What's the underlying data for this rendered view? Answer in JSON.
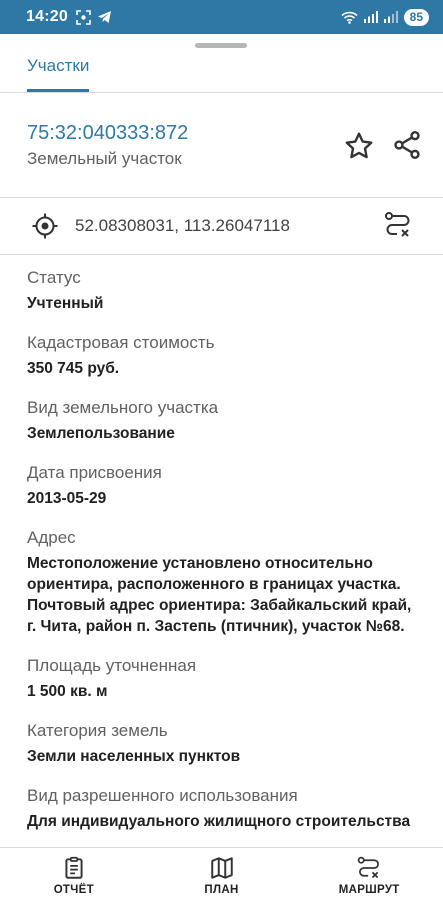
{
  "status_bar": {
    "time": "14:20",
    "battery": "85",
    "left_icons": [
      "screenshot-icon",
      "telegram-icon"
    ],
    "right_icons": [
      "wifi-icon",
      "signal-icon",
      "signal-icon"
    ]
  },
  "tabs": [
    {
      "label": "Участки",
      "active": true
    }
  ],
  "header": {
    "cadastral_number": "75:32:040333:872",
    "object_type": "Земельный участок",
    "favorite_icon": "star-icon",
    "share_icon": "share-icon"
  },
  "coordinates": {
    "text": "52.08308031, 113.26047118",
    "location_icon": "target-icon",
    "route_icon": "route-clear-icon"
  },
  "properties": [
    {
      "label": "Статус",
      "value": "Учтенный"
    },
    {
      "label": "Кадастровая стоимость",
      "value": "350 745 руб."
    },
    {
      "label": "Вид земельного участка",
      "value": "Землепользование"
    },
    {
      "label": "Дата присвоения",
      "value": "2013-05-29"
    },
    {
      "label": "Адрес",
      "value": "Местоположение установлено относительно ориентира, расположенного в границах участка. Почтовый адрес ориентира: Забайкальский край, г. Чита, район п. Застепь (птичник), участок №68."
    },
    {
      "label": "Площадь уточненная",
      "value": "1 500 кв. м"
    },
    {
      "label": "Категория земель",
      "value": "Земли населенных пунктов"
    },
    {
      "label": "Вид разрешенного использования",
      "value": "Для индивидуального жилищного строительства"
    }
  ],
  "bottom_nav": [
    {
      "label": "ОТЧЁТ",
      "icon": "report-icon"
    },
    {
      "label": "ПЛАН",
      "icon": "map-icon"
    },
    {
      "label": "МАРШРУТ",
      "icon": "route-icon"
    }
  ],
  "colors": {
    "accent": "#2c7aa8",
    "status_bar": "#2e78a6"
  }
}
